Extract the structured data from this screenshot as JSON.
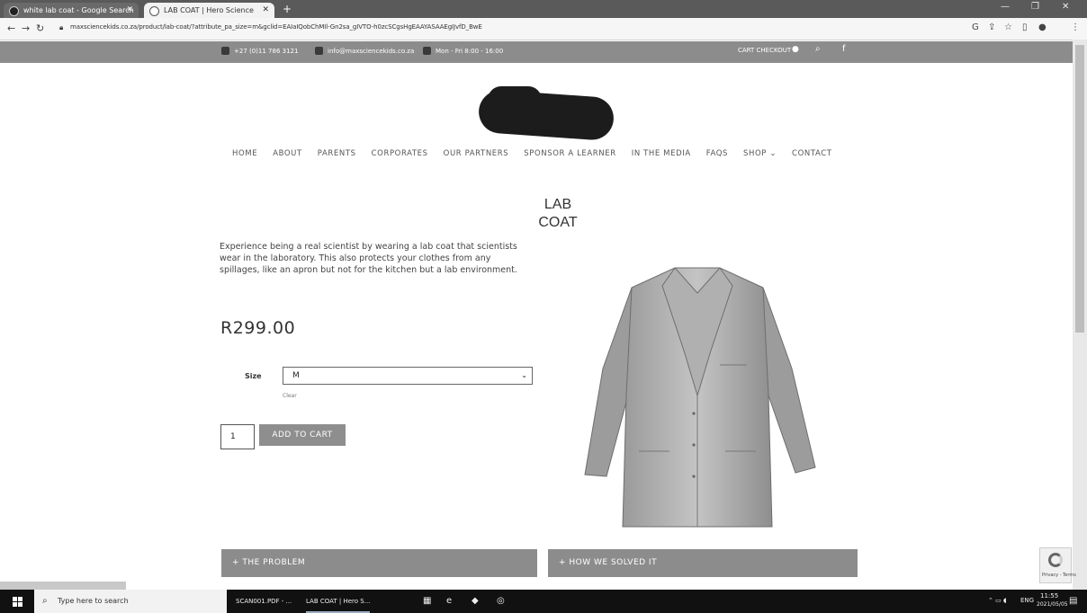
{
  "browser": {
    "tabs": [
      {
        "title": "white lab coat - Google Search",
        "close": "✕"
      },
      {
        "title": "LAB COAT | Hero Science",
        "close": "✕"
      }
    ],
    "new_tab": "+",
    "url": "maxsciencekids.co.za/product/lab-coat/?attribute_pa_size=m&gclid=EAIaIQobChMIl-Gn2sa_gIVTO-h0zcSCgsHgEAAYASAAEgIJvfD_BwE",
    "window_controls": [
      "—",
      "❐",
      "✕"
    ]
  },
  "topbar": {
    "phone": "+27 (0)11 786 3121",
    "email": "info@maxsciencekids.co.za",
    "hours": "Mon - Fri 8:00 - 16:00",
    "cart_checkout": "CART CHECKOUT"
  },
  "nav": {
    "items": [
      "HOME",
      "ABOUT",
      "PARENTS",
      "CORPORATES",
      "OUR PARTNERS",
      "SPONSOR A LEARNER",
      "IN THE MEDIA",
      "FAQS",
      "SHOP ⌄",
      "CONTACT"
    ]
  },
  "product": {
    "title_line1": "LAB",
    "title_line2": "COAT",
    "description": "Experience being a real scientist by wearing a lab coat that scientists wear in the laboratory. This also protects your clothes from any spillages, like an apron but not for the kitchen but a lab environment.",
    "price": "R299.00",
    "size_label": "Size",
    "size_value": "M",
    "clear": "Clear",
    "quantity": "1",
    "add_to_cart": "ADD TO CART"
  },
  "accordions": {
    "problem": "+ THE PROBLEM",
    "solved": "+ HOW WE SOLVED IT"
  },
  "recaptcha": {
    "text": "Privacy - Terms"
  },
  "taskbar": {
    "search_placeholder": "Type here to search",
    "items": [
      "SCAN001.PDF - ...",
      "LAB COAT | Hero S..."
    ],
    "clock_time": "11:55",
    "clock_date": "2021/05/05",
    "lang": "ENG"
  },
  "colors": {
    "bar_gray": "#8c8c8c",
    "taskbar": "#111111"
  }
}
